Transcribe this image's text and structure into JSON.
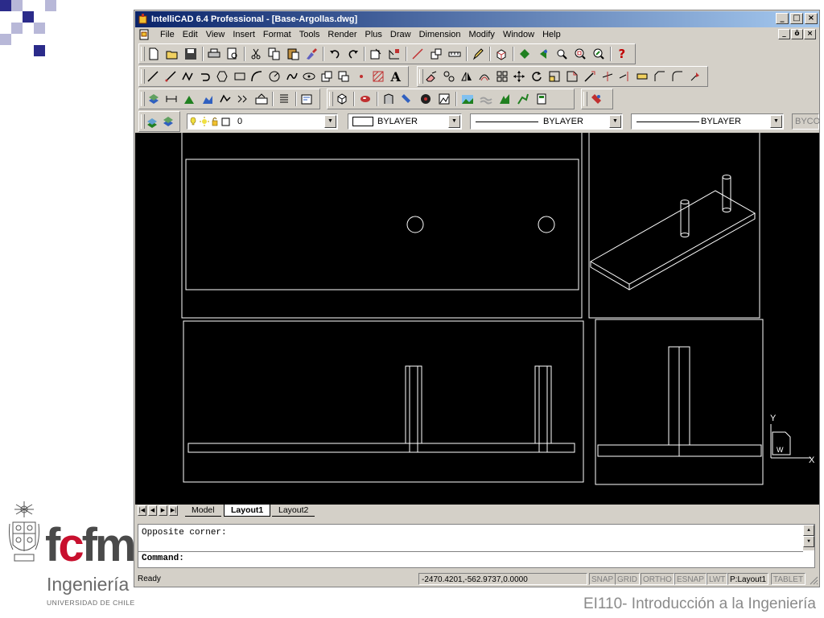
{
  "app": {
    "title": "IntelliCAD 6.4 Professional  - [Base-Argollas.dwg]",
    "window_buttons": [
      "_",
      "□",
      "×"
    ],
    "mdi_buttons": [
      "_",
      "ō",
      "×"
    ]
  },
  "menu": {
    "items": [
      "File",
      "Edit",
      "View",
      "Insert",
      "Format",
      "Tools",
      "Render",
      "Plus",
      "Draw",
      "Dimension",
      "Modify",
      "Window",
      "Help"
    ]
  },
  "properties": {
    "layer_value": "0",
    "color_value": "BYLAYER",
    "linetype_value": "BYLAYER",
    "lineweight_value": "BYLAYER",
    "extra_value": "BYCO"
  },
  "tabs": {
    "items": [
      "Model",
      "Layout1",
      "Layout2"
    ],
    "active": "Layout1"
  },
  "ucs": {
    "y_label": "Y",
    "x_label": "X",
    "w_label": "W"
  },
  "command": {
    "history": "Opposite corner:",
    "prompt": "Command:"
  },
  "status": {
    "ready": "Ready",
    "coordinates": "-2470.4201,-562.9737,0.0000",
    "buttons": [
      "SNAP",
      "GRID",
      "ORTHO",
      "ESNAP",
      "LWT",
      "P:Layout1",
      "TABLET"
    ],
    "active_button": "P:Layout1"
  },
  "slide": {
    "logo_fcfm_letters": [
      "f",
      "c",
      "f",
      "m"
    ],
    "logo_ingenieria": "Ingeniería",
    "logo_universidad": "UNIVERSIDAD DE CHILE",
    "footer_title": "EI110- Introducción a la Ingeniería"
  },
  "colors": {
    "title_gradient_start": "#0a246a",
    "title_gradient_end": "#a6caf0",
    "chrome": "#d4d0c8",
    "canvas": "#000000",
    "logo_red": "#c8102e",
    "slide_square_dark": "#2b2b8a",
    "slide_square_light": "#b8b8d8"
  }
}
